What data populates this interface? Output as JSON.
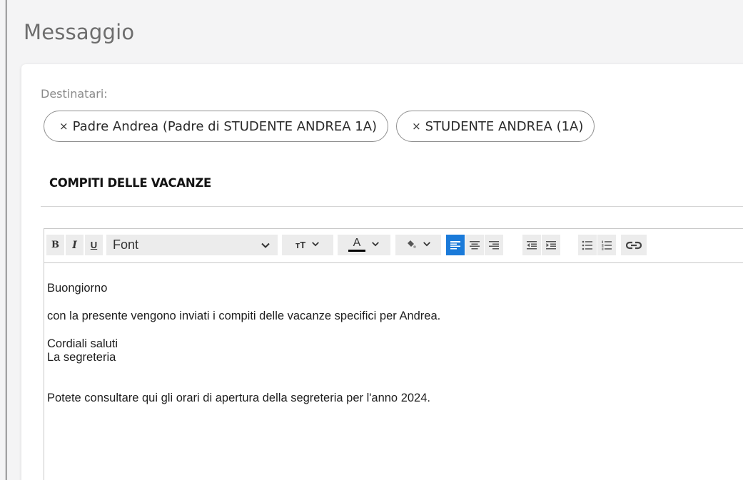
{
  "page": {
    "title": "Messaggio"
  },
  "recipients": {
    "label": "Destinatari:",
    "chips": [
      {
        "remove_glyph": "×",
        "text": "Padre Andrea (Padre di STUDENTE ANDREA 1A)"
      },
      {
        "remove_glyph": "×",
        "text": "STUDENTE ANDREA (1A)"
      }
    ]
  },
  "subject": "COMPITI DELLE VACANZE",
  "toolbar": {
    "bold": "B",
    "italic": "I",
    "underline": "U",
    "font_value": "Font",
    "font_size_label": "ᴛT",
    "text_color_label": "A",
    "link_label": "GD"
  },
  "message": {
    "lines": [
      "Buongiorno",
      "con la presente vengono inviati i compiti delle vacanze specifici per Andrea.",
      "Cordiali saluti",
      "La segreteria",
      "Potete consultare qui gli orari di apertura della segreteria per l'anno 2024."
    ]
  },
  "colors": {
    "accent": "#1a7ad9",
    "title": "#6d6d6d"
  }
}
